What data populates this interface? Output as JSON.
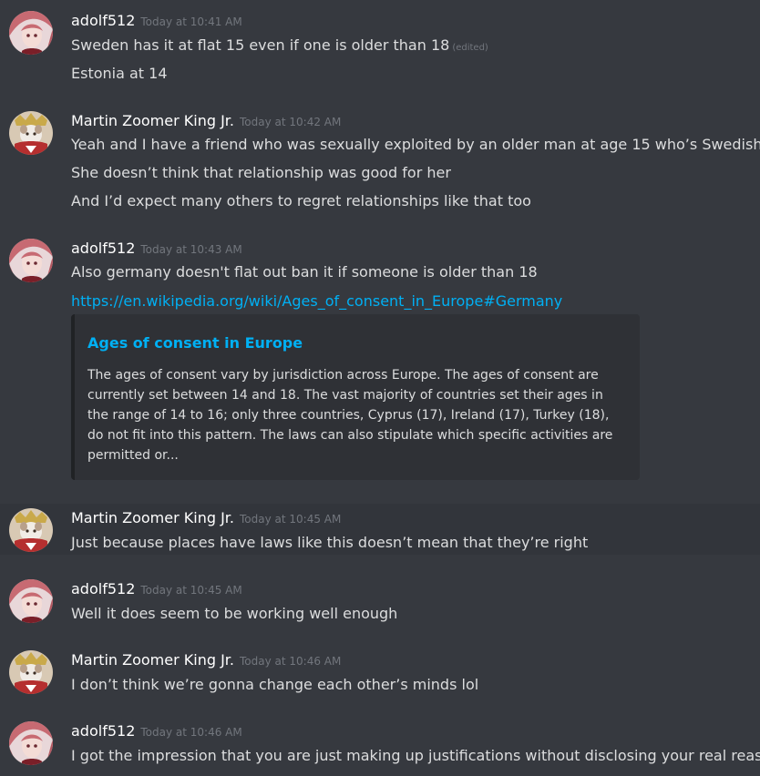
{
  "messages": [
    {
      "author": "adolf512",
      "time": "Today at 10:41 AM",
      "lines": [
        "Sweden has it at flat 15 even if one is older than 18",
        "Estonia at 14"
      ],
      "edited_label": "(edited)"
    },
    {
      "author": "Martin Zoomer King Jr.",
      "time": "Today at 10:42 AM",
      "lines": [
        "Yeah and I have a friend who was sexually exploited by an older man at age 15 who’s Swedish",
        "She doesn’t think that relationship was good for her",
        "And I’d expect many others to regret relationships like that too"
      ]
    },
    {
      "author": "adolf512",
      "time": "Today at 10:43 AM",
      "lines": [
        "Also germany doesn't flat out ban it if someone is older than 18"
      ],
      "link": "https://en.wikipedia.org/wiki/Ages_of_consent_in_Europe#Germany",
      "embed": {
        "title": "Ages of consent in Europe",
        "description": "The ages of consent vary by jurisdiction across Europe. The ages of consent are currently set between 14 and 18. The vast majority of countries set their ages in the range of 14 to 16; only three countries, Cyprus (17), Ireland (17), Turkey (18), do not fit into this pattern. The laws can also stipulate which specific activities are permitted or..."
      }
    },
    {
      "author": "Martin Zoomer King Jr.",
      "time": "Today at 10:45 AM",
      "lines": [
        "Just because places have laws like this doesn’t mean that they’re right"
      ]
    },
    {
      "author": "adolf512",
      "time": "Today at 10:45 AM",
      "lines": [
        "Well it does seem to be working well enough"
      ]
    },
    {
      "author": "Martin Zoomer King Jr.",
      "time": "Today at 10:46 AM",
      "lines": [
        "I don’t think we’re gonna change each other’s minds lol"
      ]
    },
    {
      "author": "adolf512",
      "time": "Today at 10:46 AM",
      "lines": [
        "I got the impression that you are just making up justifications without disclosing your real reason"
      ]
    }
  ]
}
